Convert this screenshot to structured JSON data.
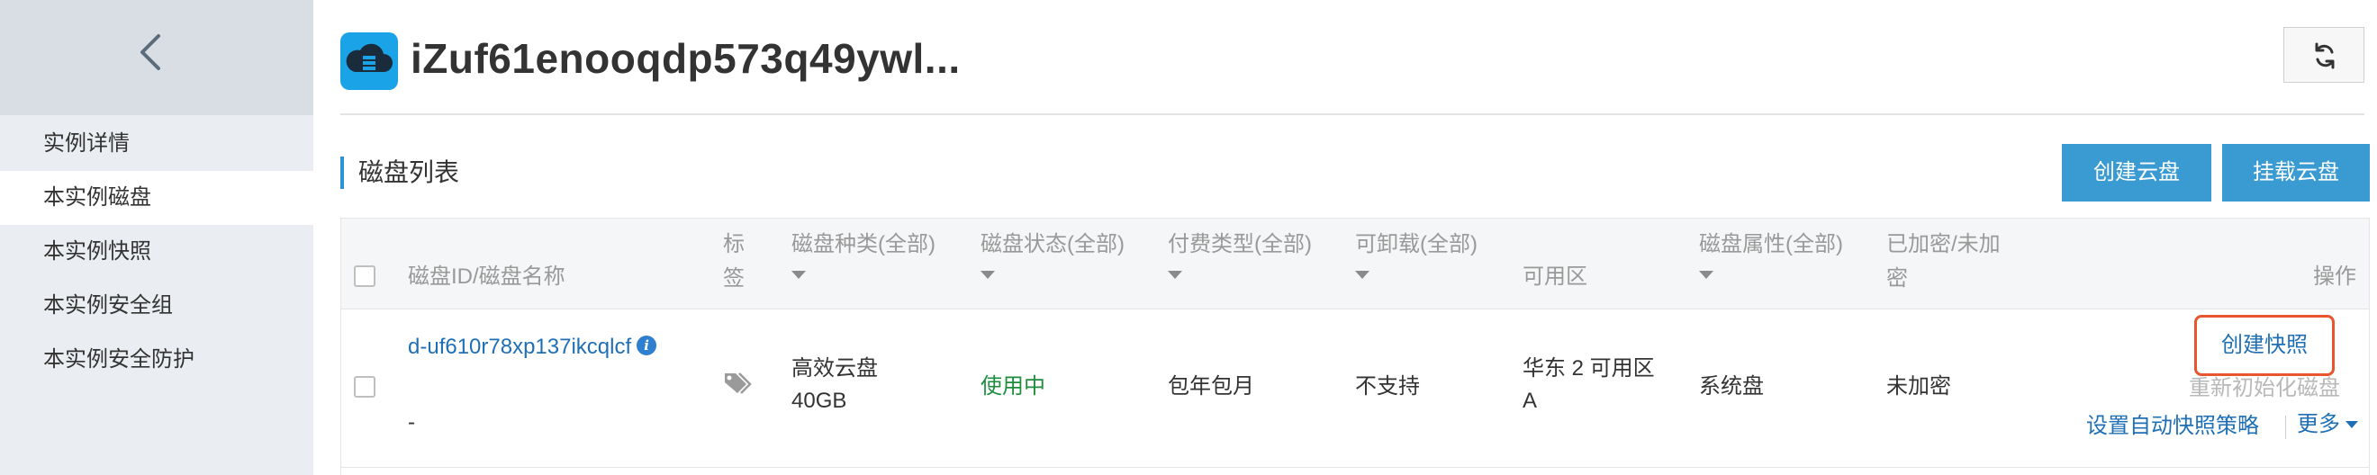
{
  "sidebar": {
    "back_icon": "chevron-left-icon",
    "items": [
      {
        "label": "实例详情",
        "active": false
      },
      {
        "label": "本实例磁盘",
        "active": true
      },
      {
        "label": "本实例快照",
        "active": false
      },
      {
        "label": "本实例安全组",
        "active": false
      },
      {
        "label": "本实例安全防护",
        "active": false
      }
    ]
  },
  "header": {
    "app_icon": "cloud-server-icon",
    "title": "iZuf61enooqdp573q49ywl...",
    "refresh_icon": "refresh-icon"
  },
  "section": {
    "title": "磁盘列表",
    "create_disk_label": "创建云盘",
    "attach_disk_label": "挂载云盘"
  },
  "table": {
    "headers": {
      "disk_id": "磁盘ID/磁盘名称",
      "tag_line1": "标",
      "tag_line2": "签",
      "disk_type": "磁盘种类(全部)",
      "disk_status": "磁盘状态(全部)",
      "billing": "付费类型(全部)",
      "detachable": "可卸载(全部)",
      "zone": "可用区",
      "attribute": "磁盘属性(全部)",
      "encrypted_line1": "已加密/未加",
      "encrypted_line2": "密",
      "actions": "操作"
    },
    "rows": [
      {
        "disk_id": "d-uf610r78xp137ikcqlcf",
        "disk_name": "-",
        "tag_icon": "tag-icon",
        "disk_type": "高效云盘",
        "disk_size": "40GB",
        "status": "使用中",
        "billing": "包年包月",
        "detachable": "不支持",
        "zone_line1": "华东 2 可用区",
        "zone_line2": "A",
        "attribute": "系统盘",
        "encrypted": "未加密",
        "actions": {
          "create_snapshot": "创建快照",
          "reinit_disk": "重新初始化磁盘",
          "auto_snapshot_policy": "设置自动快照策略",
          "more": "更多"
        }
      }
    ]
  },
  "colors": {
    "accent": "#3a9bd2",
    "link": "#1f6fb5",
    "status_ok": "#1e8e3e",
    "highlight_border": "#e8552f"
  }
}
